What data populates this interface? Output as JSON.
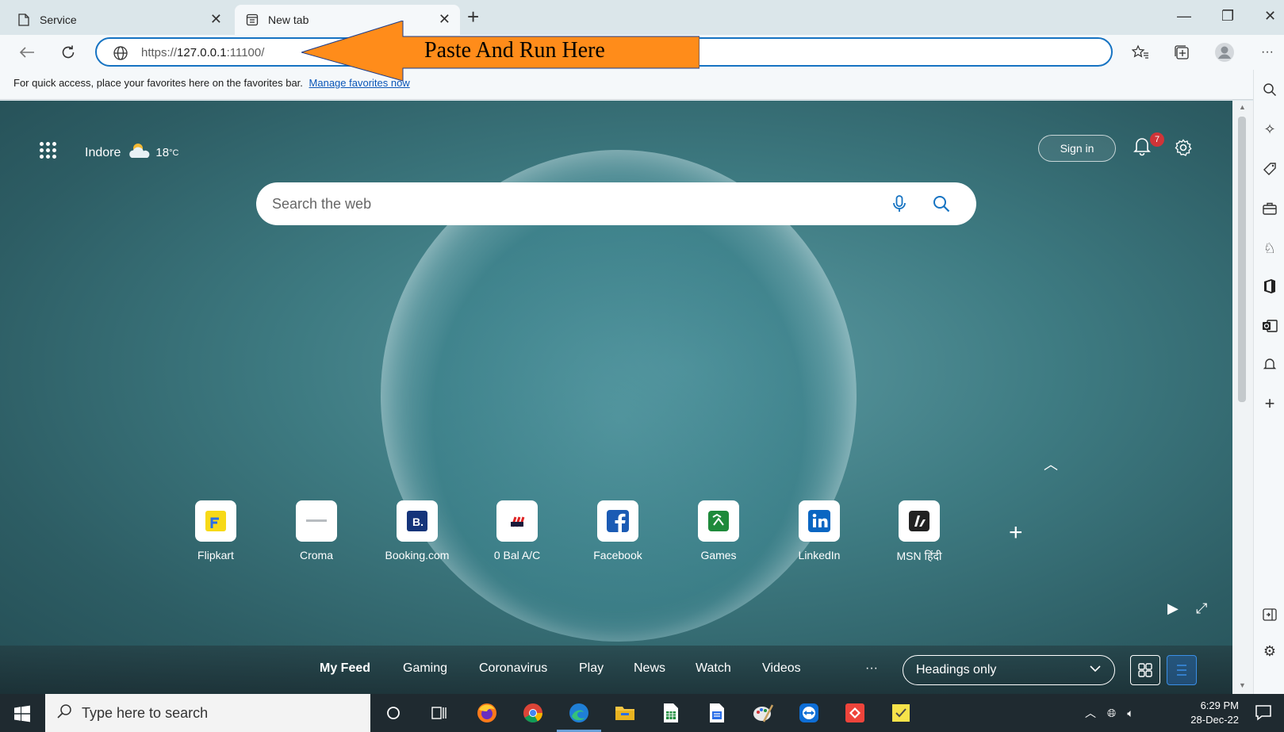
{
  "tabs": [
    {
      "title": "Service",
      "active": false
    },
    {
      "title": "New tab",
      "active": true
    }
  ],
  "address": {
    "scheme": "https://",
    "host": "127.0.0.1",
    "port_path": ":11100/"
  },
  "annotation": {
    "text": "Paste And Run Here",
    "color": "#ff8c1a"
  },
  "favorites_bar": {
    "message": "For quick access, place your favorites here on the favorites bar.",
    "link": "Manage favorites now"
  },
  "weather": {
    "city": "Indore",
    "temperature": "18",
    "unit": "°C"
  },
  "header": {
    "sign_in": "Sign in",
    "notification_count": "7"
  },
  "search": {
    "placeholder": "Search the web"
  },
  "quick_links": [
    {
      "label": "Flipkart",
      "icon": "flipkart-icon"
    },
    {
      "label": "Croma",
      "icon": "croma-icon"
    },
    {
      "label": "Booking.com",
      "icon": "booking-icon"
    },
    {
      "label": "0 Bal A/C",
      "icon": "kotak-icon"
    },
    {
      "label": "Facebook",
      "icon": "facebook-icon"
    },
    {
      "label": "Games",
      "icon": "games-icon"
    },
    {
      "label": "LinkedIn",
      "icon": "linkedin-icon"
    },
    {
      "label": "MSN हिंदी",
      "icon": "msn-icon"
    }
  ],
  "feed": {
    "tabs": [
      "My Feed",
      "Gaming",
      "Coronavirus",
      "Play",
      "News",
      "Watch",
      "Videos"
    ],
    "more": "···",
    "layout_select": "Headings only"
  },
  "taskbar": {
    "search_placeholder": "Type here to search",
    "time": "6:29 PM",
    "date": "28-Dec-22"
  },
  "colors": {
    "accent": "#1673c2",
    "badge": "#d13438"
  }
}
